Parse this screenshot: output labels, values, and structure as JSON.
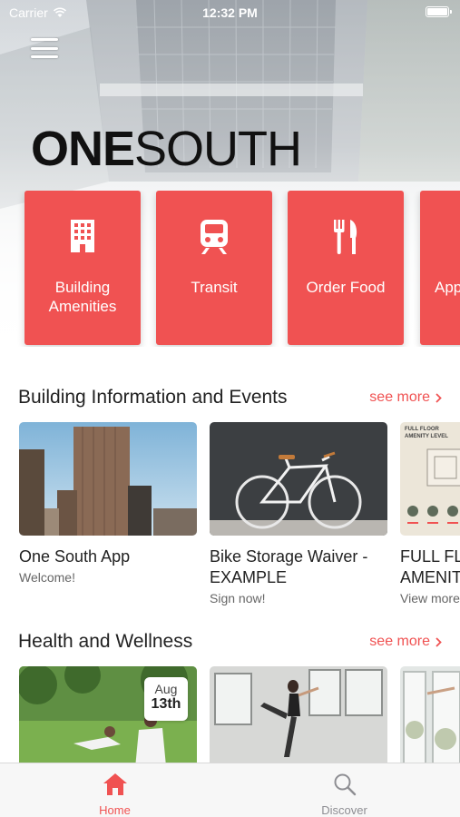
{
  "status_bar": {
    "carrier": "Carrier",
    "time": "12:32 PM"
  },
  "hero": {
    "logo_bold": "ONE",
    "logo_thin": "SOUTH",
    "menu_icon": "hamburger-menu-icon"
  },
  "quick_actions": [
    {
      "label": "Building Amenities",
      "icon": "building-icon"
    },
    {
      "label": "Transit",
      "icon": "train-icon"
    },
    {
      "label": "Order Food",
      "icon": "fork-knife-icon"
    },
    {
      "label": "App",
      "icon": "app-icon"
    }
  ],
  "sections": [
    {
      "title": "Building Information and Events",
      "see_more": "see more",
      "cards": [
        {
          "title": "One South App",
          "subtitle": "Welcome!",
          "image": "city-skyline"
        },
        {
          "title": "Bike Storage Waiver -",
          "title_line2": "EXAMPLE",
          "subtitle": "Sign now!",
          "image": "bicycle"
        },
        {
          "title": "FULL FL",
          "title_line2": "AMENIT",
          "subtitle": "View more",
          "image": "floor-plan",
          "image_text": "FULL FLOOR AMENITY LEVEL"
        }
      ]
    },
    {
      "title": "Health and Wellness",
      "see_more": "see more",
      "cards": [
        {
          "image": "yoga-park",
          "badge_month": "Aug",
          "badge_day": "13th"
        },
        {
          "image": "dance-studio"
        },
        {
          "image": "window-stretch"
        }
      ]
    }
  ],
  "tabbar": {
    "items": [
      {
        "label": "Home",
        "icon": "home-icon",
        "active": true
      },
      {
        "label": "Discover",
        "icon": "search-icon",
        "active": false
      }
    ]
  },
  "colors": {
    "accent": "#f05252",
    "tab_inactive": "#8e8e93"
  }
}
